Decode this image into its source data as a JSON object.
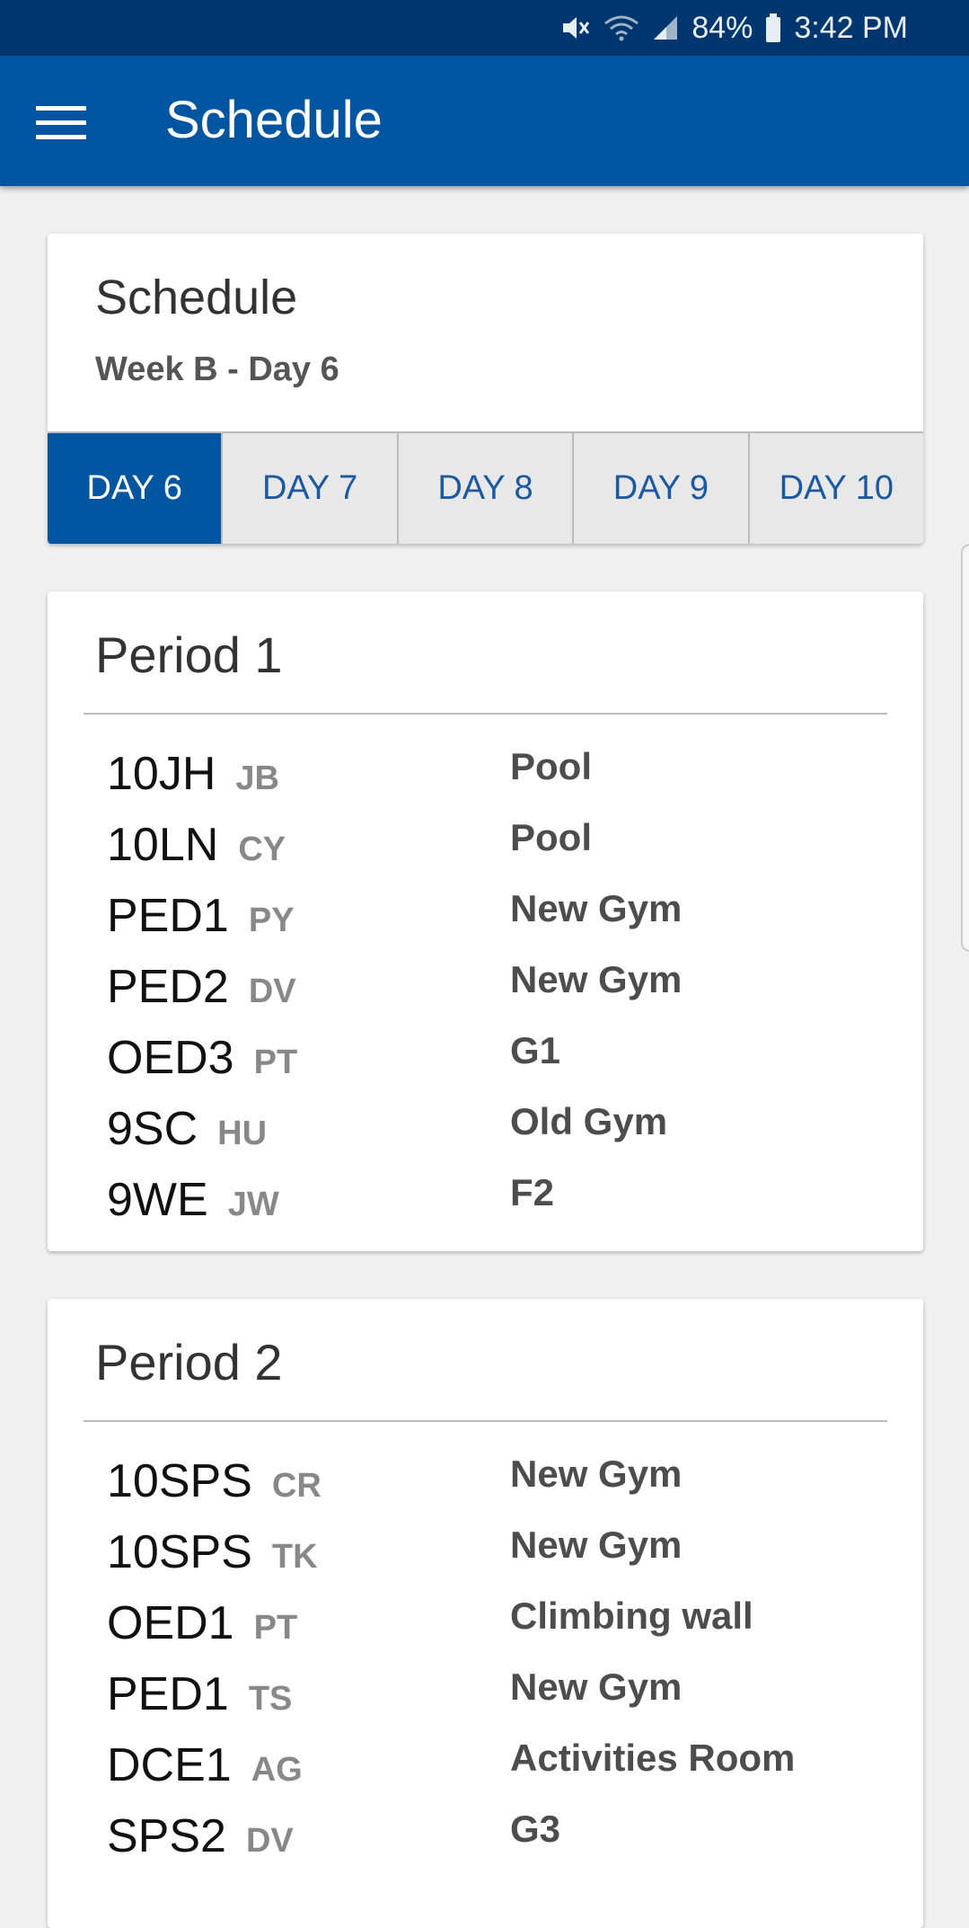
{
  "status_bar": {
    "battery": "84%",
    "time": "3:42 PM",
    "icons": [
      "mute-icon",
      "wifi-icon",
      "signal-icon",
      "battery-icon"
    ]
  },
  "app_bar": {
    "title": "Schedule",
    "menu_icon": "hamburger-icon"
  },
  "header_card": {
    "title": "Schedule",
    "subtitle": "Week B - Day 6",
    "tabs": [
      {
        "label": "DAY 6",
        "active": true
      },
      {
        "label": "DAY 7",
        "active": false
      },
      {
        "label": "DAY 8",
        "active": false
      },
      {
        "label": "DAY 9",
        "active": false
      },
      {
        "label": "DAY 10",
        "active": false
      }
    ]
  },
  "periods": [
    {
      "title": "Period 1",
      "classes": [
        {
          "code": "10JH",
          "teacher": "JB",
          "room": "Pool"
        },
        {
          "code": "10LN",
          "teacher": "CY",
          "room": "Pool"
        },
        {
          "code": "PED1",
          "teacher": "PY",
          "room": "New Gym"
        },
        {
          "code": "PED2",
          "teacher": "DV",
          "room": "New Gym"
        },
        {
          "code": "OED3",
          "teacher": "PT",
          "room": "G1"
        },
        {
          "code": "9SC",
          "teacher": "HU",
          "room": "Old Gym"
        },
        {
          "code": "9WE",
          "teacher": "JW",
          "room": "F2"
        }
      ]
    },
    {
      "title": "Period 2",
      "classes": [
        {
          "code": "10SPS",
          "teacher": "CR",
          "room": "New Gym"
        },
        {
          "code": "10SPS",
          "teacher": "TK",
          "room": "New Gym"
        },
        {
          "code": "OED1",
          "teacher": "PT",
          "room": "Climbing wall"
        },
        {
          "code": "PED1",
          "teacher": "TS",
          "room": "New Gym"
        },
        {
          "code": "DCE1",
          "teacher": "AG",
          "room": "Activities Room"
        },
        {
          "code": "SPS2",
          "teacher": "DV",
          "room": "G3"
        }
      ]
    }
  ],
  "colors": {
    "status_bar": "#00366e",
    "app_bar": "#0055a0",
    "tab_active": "#0055a0",
    "tab_text": "#1b5aa3"
  }
}
